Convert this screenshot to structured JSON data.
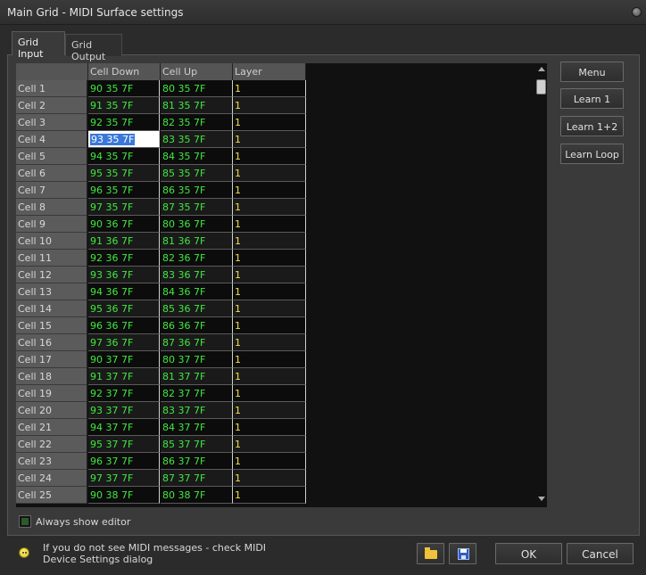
{
  "window": {
    "title": "Main Grid - MIDI Surface settings"
  },
  "tabs": [
    {
      "label": "Grid Input",
      "active": true
    },
    {
      "label": "Grid Output",
      "active": false
    }
  ],
  "grid": {
    "columns": [
      "",
      "Cell Down",
      "Cell Up",
      "Layer"
    ],
    "editing_row": 3,
    "rows": [
      {
        "name": "Cell 1",
        "down": "90 35 7F",
        "up": "80 35 7F",
        "layer": "1"
      },
      {
        "name": "Cell 2",
        "down": "91 35 7F",
        "up": "81 35 7F",
        "layer": "1"
      },
      {
        "name": "Cell 3",
        "down": "92 35 7F",
        "up": "82 35 7F",
        "layer": "1"
      },
      {
        "name": "Cell 4",
        "down": "93 35 7F",
        "up": "83 35 7F",
        "layer": "1"
      },
      {
        "name": "Cell 5",
        "down": "94 35 7F",
        "up": "84 35 7F",
        "layer": "1"
      },
      {
        "name": "Cell 6",
        "down": "95 35 7F",
        "up": "85 35 7F",
        "layer": "1"
      },
      {
        "name": "Cell 7",
        "down": "96 35 7F",
        "up": "86 35 7F",
        "layer": "1"
      },
      {
        "name": "Cell 8",
        "down": "97 35 7F",
        "up": "87 35 7F",
        "layer": "1"
      },
      {
        "name": "Cell 9",
        "down": "90 36 7F",
        "up": "80 36 7F",
        "layer": "1"
      },
      {
        "name": "Cell 10",
        "down": "91 36 7F",
        "up": "81 36 7F",
        "layer": "1"
      },
      {
        "name": "Cell 11",
        "down": "92 36 7F",
        "up": "82 36 7F",
        "layer": "1"
      },
      {
        "name": "Cell 12",
        "down": "93 36 7F",
        "up": "83 36 7F",
        "layer": "1"
      },
      {
        "name": "Cell 13",
        "down": "94 36 7F",
        "up": "84 36 7F",
        "layer": "1"
      },
      {
        "name": "Cell 14",
        "down": "95 36 7F",
        "up": "85 36 7F",
        "layer": "1"
      },
      {
        "name": "Cell 15",
        "down": "96 36 7F",
        "up": "86 36 7F",
        "layer": "1"
      },
      {
        "name": "Cell 16",
        "down": "97 36 7F",
        "up": "87 36 7F",
        "layer": "1"
      },
      {
        "name": "Cell 17",
        "down": "90 37 7F",
        "up": "80 37 7F",
        "layer": "1"
      },
      {
        "name": "Cell 18",
        "down": "91 37 7F",
        "up": "81 37 7F",
        "layer": "1"
      },
      {
        "name": "Cell 19",
        "down": "92 37 7F",
        "up": "82 37 7F",
        "layer": "1"
      },
      {
        "name": "Cell 20",
        "down": "93 37 7F",
        "up": "83 37 7F",
        "layer": "1"
      },
      {
        "name": "Cell 21",
        "down": "94 37 7F",
        "up": "84 37 7F",
        "layer": "1"
      },
      {
        "name": "Cell 22",
        "down": "95 37 7F",
        "up": "85 37 7F",
        "layer": "1"
      },
      {
        "name": "Cell 23",
        "down": "96 37 7F",
        "up": "86 37 7F",
        "layer": "1"
      },
      {
        "name": "Cell 24",
        "down": "97 37 7F",
        "up": "87 37 7F",
        "layer": "1"
      },
      {
        "name": "Cell 25",
        "down": "90 38 7F",
        "up": "80 38 7F",
        "layer": "1"
      }
    ]
  },
  "side_buttons": [
    "Menu",
    "Learn 1",
    "Learn 1+2",
    "Learn Loop"
  ],
  "options": {
    "always_show_editor_label": "Always show editor",
    "always_show_editor_checked": false
  },
  "hint": {
    "text": "If you do not see MIDI messages - check MIDI Device Settings dialog",
    "icon": "smiley-icon"
  },
  "footer": {
    "ok_label": "OK",
    "cancel_label": "Cancel",
    "open_icon": "folder-icon",
    "save_icon": "save-disk-icon"
  },
  "colors": {
    "value_green": "#3fe83f",
    "layer_yellow": "#f0e04a",
    "selection_blue": "#3a78d8"
  }
}
